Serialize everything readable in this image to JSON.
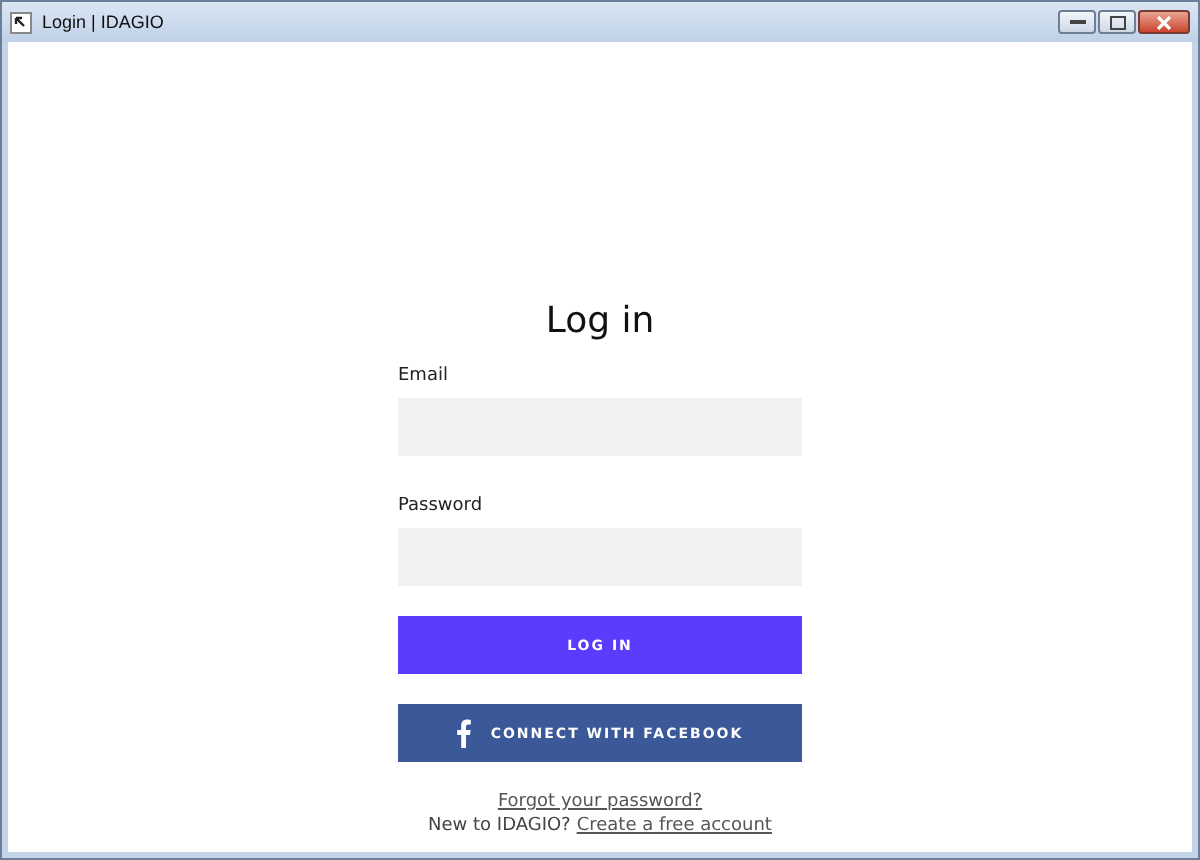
{
  "window": {
    "title": "Login | IDAGIO"
  },
  "form": {
    "title": "Log in",
    "fields": [
      {
        "label": "Email"
      },
      {
        "label": "Password"
      }
    ],
    "login_button": "LOG IN",
    "facebook_button": "CONNECT WITH FACEBOOK",
    "forgot_link": "Forgot your password?",
    "signup_prompt": "New to IDAGIO?",
    "signup_link": "Create a free account"
  }
}
